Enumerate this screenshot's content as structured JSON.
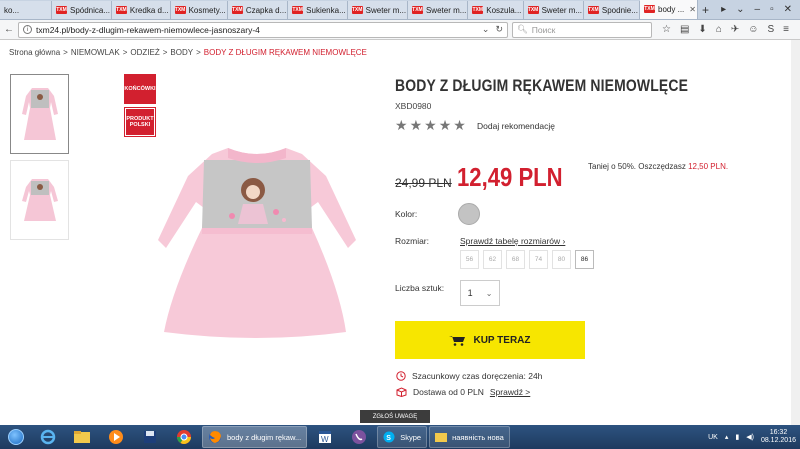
{
  "browser": {
    "tabs": [
      {
        "label": "ko..."
      },
      {
        "label": "Spódnica..."
      },
      {
        "label": "Kredka d..."
      },
      {
        "label": "Kosmety..."
      },
      {
        "label": "Czapka d..."
      },
      {
        "label": "Sukienka..."
      },
      {
        "label": "Sweter m..."
      },
      {
        "label": "Sweter m..."
      },
      {
        "label": "Koszula..."
      },
      {
        "label": "Sweter m..."
      },
      {
        "label": "Spodnie..."
      },
      {
        "label": "body ..."
      }
    ],
    "favicon_text": "TXM",
    "url": "txm24.pl/body-z-dlugim-rekawem-niemowlece-jasnoszary-4",
    "search_placeholder": "Поиск"
  },
  "breadcrumb": {
    "items": [
      "Strona główna",
      ">",
      "NIEMOWLAK",
      ">",
      "ODZIEŻ",
      ">",
      "BODY",
      ">"
    ],
    "current": "BODY Z DŁUGIM RĘKAWEM NIEMOWLĘCE"
  },
  "badges": {
    "koncowki": "KOŃCÓWKI",
    "produkt": "PRODUKT POLSKI"
  },
  "product": {
    "title": "BODY Z DŁUGIM RĘKAWEM NIEMOWLĘCE",
    "sku": "XBD0980",
    "rating_stars": 5,
    "add_review": "Dodaj rekomendację",
    "old_price": "24,99 PLN",
    "new_price": "12,49 PLN",
    "saving_prefix": "Taniej o 50%. Oszczędzasz",
    "saving_amount": "12,50 PLN.",
    "color_label": "Kolor:",
    "color_swatch": "#c3c3c3",
    "size_label": "Rozmiar:",
    "size_chart_link": "Sprawdź tabelę rozmiarów ›",
    "sizes": [
      "56",
      "62",
      "68",
      "74",
      "80",
      "86"
    ],
    "qty_label": "Liczba sztuk:",
    "qty_value": "1",
    "buy_button": "KUP TERAZ",
    "delivery_time": "Szacunkowy czas doręczenia: 24h",
    "shipping_text": "Dostawa od 0 PLN",
    "shipping_link": "Sprawdź >"
  },
  "report_button": "ZGŁOŚ UWAGĘ",
  "taskbar": {
    "tasks": [
      {
        "label": "body z długim rękaw..."
      },
      {
        "label": "Skype"
      },
      {
        "label": "наявність нова"
      }
    ],
    "lang": "UK",
    "time": "16:32",
    "date": "08.12.2016"
  },
  "colors": {
    "brand_red": "#d2202f",
    "buy_yellow": "#f7e600"
  }
}
